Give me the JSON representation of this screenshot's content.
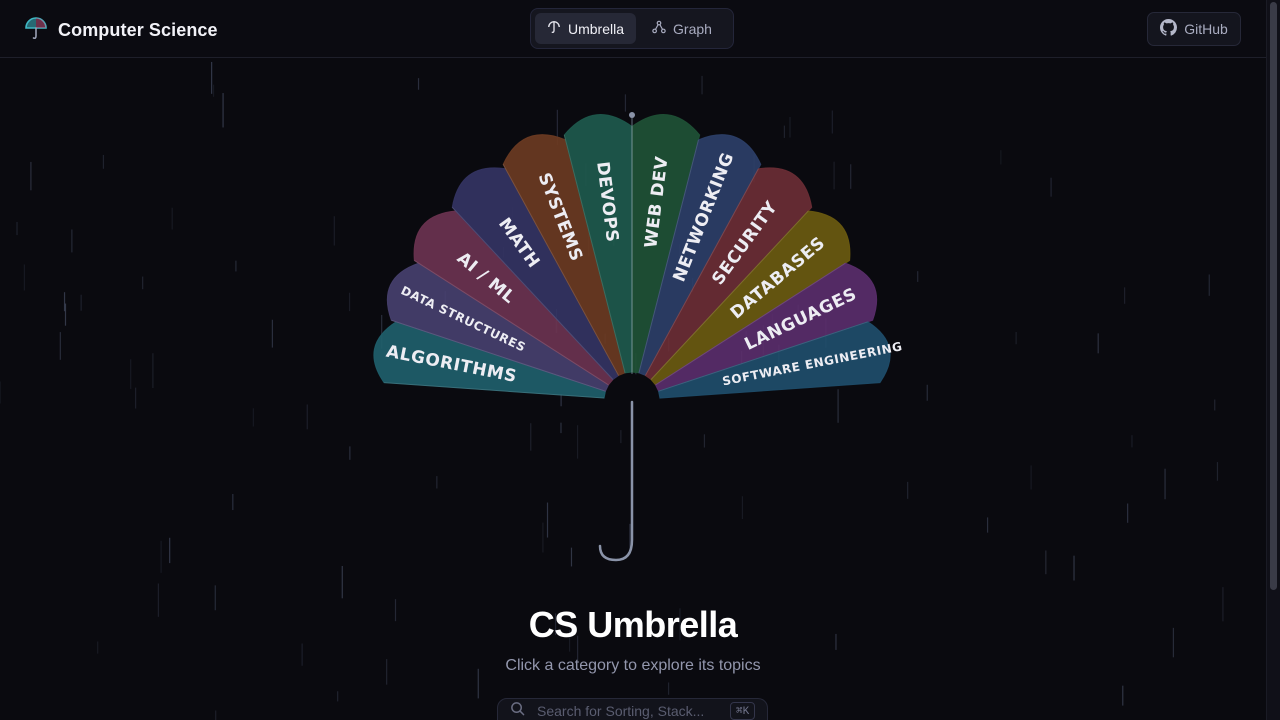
{
  "header": {
    "brand_title": "Computer Science",
    "nav": [
      {
        "label": "Umbrella",
        "icon": "umbrella-icon",
        "active": true
      },
      {
        "label": "Graph",
        "icon": "graph-icon",
        "active": false
      }
    ],
    "github_label": "GitHub"
  },
  "umbrella": {
    "categories": [
      {
        "label": "ALGORITHMS",
        "color": "#1f5f6b"
      },
      {
        "label": "DATA STRUCTURES",
        "color": "#47406e"
      },
      {
        "label": "AI / ML",
        "color": "#6b3350"
      },
      {
        "label": "MATH",
        "color": "#343463"
      },
      {
        "label": "SYSTEMS",
        "color": "#6b3b22"
      },
      {
        "label": "DEVOPS",
        "color": "#1e5a4d"
      },
      {
        "label": "WEB DEV",
        "color": "#1f5236"
      },
      {
        "label": "NETWORKING",
        "color": "#2c3f68"
      },
      {
        "label": "SECURITY",
        "color": "#6b2e35"
      },
      {
        "label": "DATABASES",
        "color": "#6b5b10"
      },
      {
        "label": "LANGUAGES",
        "color": "#5a2e6b"
      },
      {
        "label": "SOFTWARE ENGINEERING",
        "color": "#1f4e6b"
      }
    ]
  },
  "hero": {
    "title": "CS Umbrella",
    "subtitle": "Click a category to explore its topics"
  },
  "search": {
    "placeholder": "Search for Sorting, Stack...",
    "shortcut": "⌘K"
  },
  "colors": {
    "background": "#0a0a0f",
    "accent_teal": "#3fb8c4",
    "shaft": "#8a93a8"
  }
}
